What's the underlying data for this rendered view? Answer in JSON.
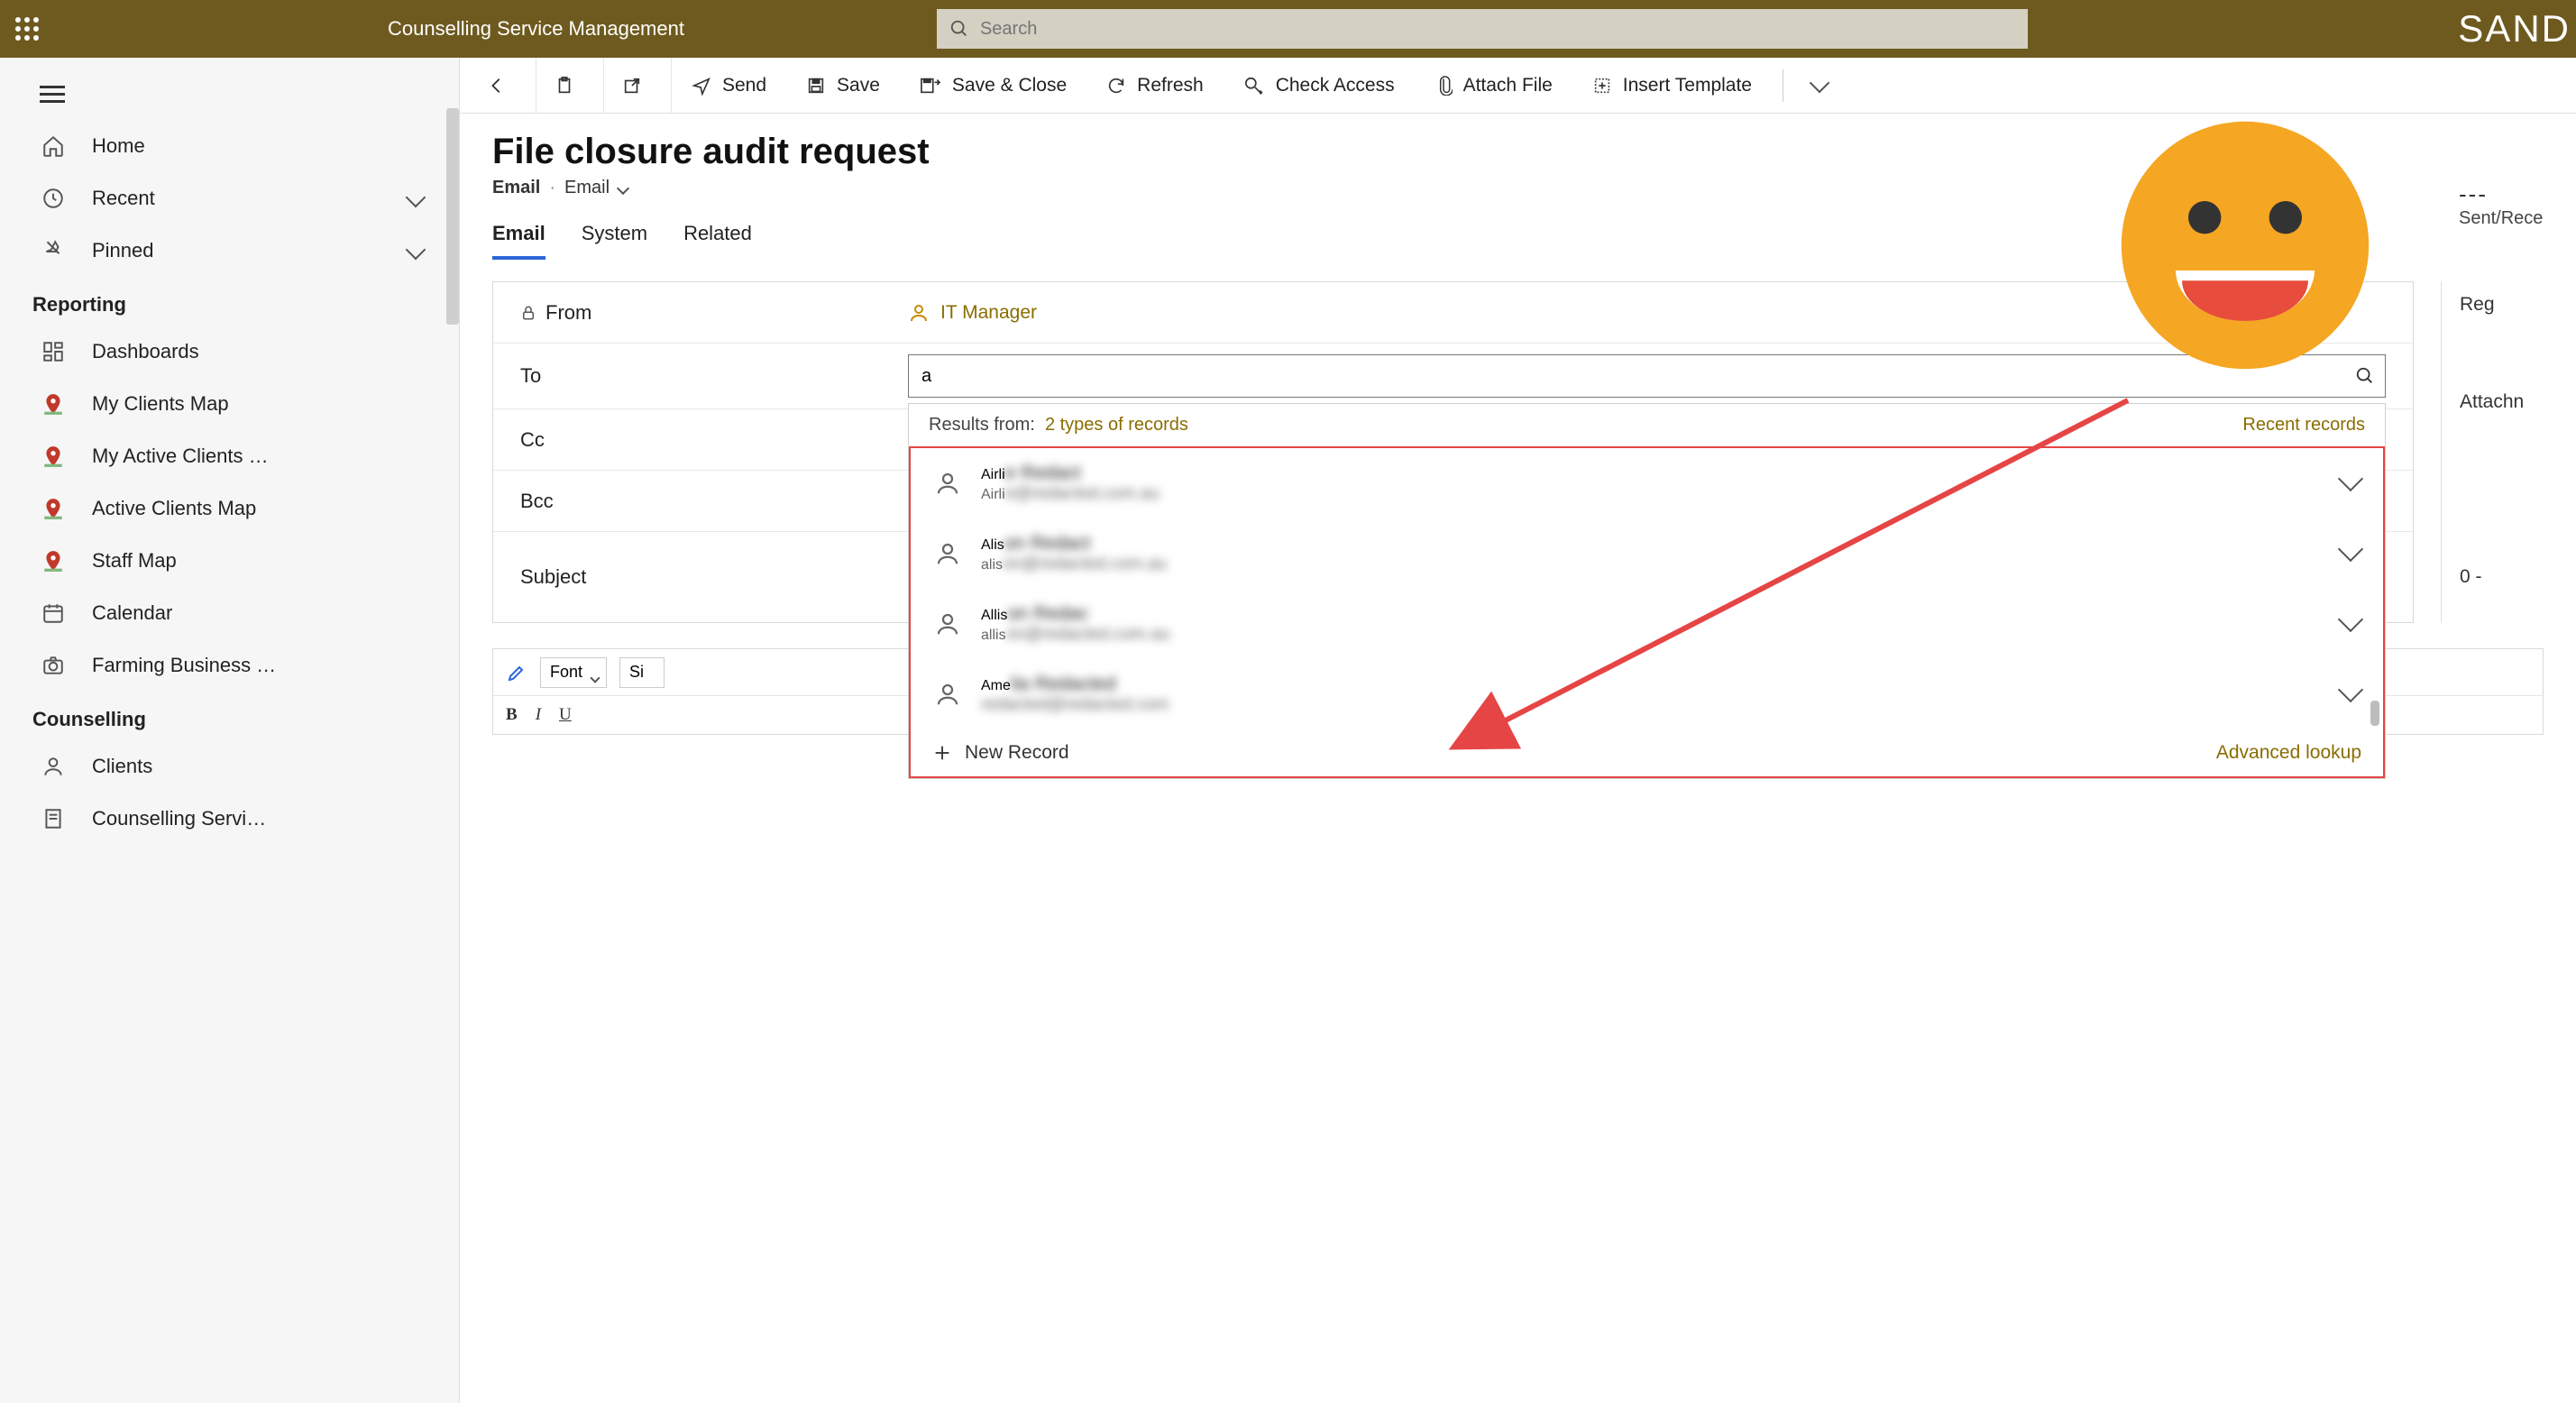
{
  "header": {
    "app_title": "Counselling Service Management",
    "search_placeholder": "Search",
    "env_label": "SAND"
  },
  "sidebar": {
    "items": [
      {
        "label": "Home",
        "icon": "home"
      },
      {
        "label": "Recent",
        "icon": "clock",
        "expandable": true
      },
      {
        "label": "Pinned",
        "icon": "pin",
        "expandable": true
      }
    ],
    "sections": [
      {
        "title": "Reporting",
        "items": [
          {
            "label": "Dashboards",
            "icon": "dashboard"
          },
          {
            "label": "My Clients Map",
            "icon": "map-pin"
          },
          {
            "label": "My Active Clients …",
            "icon": "map-pin"
          },
          {
            "label": "Active Clients Map",
            "icon": "map-pin"
          },
          {
            "label": "Staff Map",
            "icon": "map-pin"
          },
          {
            "label": "Calendar",
            "icon": "calendar"
          },
          {
            "label": "Farming Business …",
            "icon": "camera"
          }
        ]
      },
      {
        "title": "Counselling",
        "items": [
          {
            "label": "Clients",
            "icon": "person"
          },
          {
            "label": "Counselling Servi…",
            "icon": "doc"
          }
        ]
      }
    ]
  },
  "commandbar": {
    "send": "Send",
    "save": "Save",
    "save_close": "Save & Close",
    "refresh": "Refresh",
    "check_access": "Check Access",
    "attach_file": "Attach File",
    "insert_template": "Insert Template"
  },
  "page": {
    "title": "File closure audit request",
    "entity": "Email",
    "form_name": "Email",
    "tabs": [
      "Email",
      "System",
      "Related"
    ],
    "active_tab": "Email"
  },
  "meta": {
    "status_value": "---",
    "status_label": "Sent/Rece"
  },
  "form": {
    "from_label": "From",
    "from_value": "IT Manager",
    "to_label": "To",
    "to_input_value": "a",
    "cc_label": "Cc",
    "bcc_label": "Bcc",
    "subject_label": "Subject"
  },
  "lookup": {
    "results_from_label": "Results from:",
    "results_from_value": "2 types of records",
    "recent_label": "Recent records",
    "items": [
      {
        "name_prefix": "Airli",
        "name_rest": "e Redact",
        "email_prefix": "Airli",
        "email_rest": "e@redacted.com.au"
      },
      {
        "name_prefix": "Alis",
        "name_rest": "on Redact",
        "email_prefix": "alis",
        "email_rest": "on@redacted.com.au"
      },
      {
        "name_prefix": "Allis",
        "name_rest": "on Redac",
        "email_prefix": "allis",
        "email_rest": "on@redacted.com.au"
      },
      {
        "name_prefix": "Ame",
        "name_rest": "lia Redacted",
        "email_prefix": "",
        "email_rest": "redacted@redacted.com"
      }
    ],
    "new_record": "New Record",
    "advanced": "Advanced lookup"
  },
  "side_panel": {
    "regarding_label": "Reg",
    "attachment_label": "Attachn",
    "attachment_count": "0 -"
  },
  "editor": {
    "font_label": "Font",
    "size_prefix": "Si"
  }
}
